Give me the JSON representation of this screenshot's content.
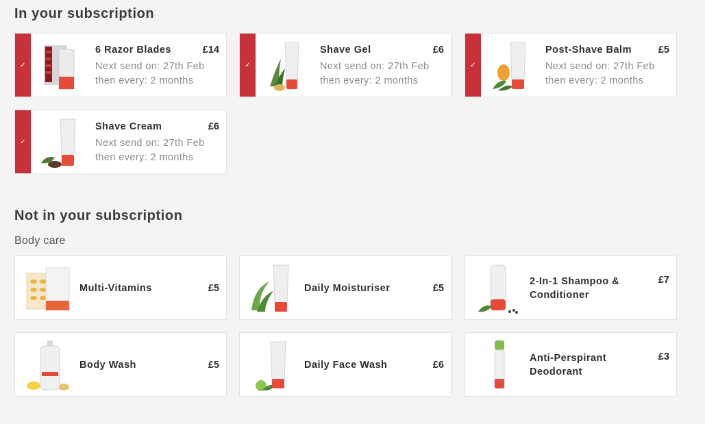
{
  "in_subscription": {
    "title": "In your subscription",
    "items": [
      {
        "name": "6 Razor Blades",
        "price": "£14",
        "next_send": "Next send on: 27th Feb",
        "frequency": "then every: 2 months"
      },
      {
        "name": "Shave Gel",
        "price": "£6",
        "next_send": "Next send on: 27th Feb",
        "frequency": "then every: 2 months"
      },
      {
        "name": "Post-Shave Balm",
        "price": "£5",
        "next_send": "Next send on: 27th Feb",
        "frequency": "then every: 2 months"
      },
      {
        "name": "Shave Cream",
        "price": "£6",
        "next_send": "Next send on: 27th Feb",
        "frequency": "then every: 2 months"
      }
    ]
  },
  "not_in_subscription": {
    "title": "Not in your subscription",
    "category": "Body care",
    "items": [
      {
        "name": "Multi-Vitamins",
        "price": "£5"
      },
      {
        "name": "Daily Moisturiser",
        "price": "£5"
      },
      {
        "name": "2-In-1 Shampoo & Conditioner",
        "price": "£7"
      },
      {
        "name": "Body Wash",
        "price": "£5"
      },
      {
        "name": "Daily Face Wash",
        "price": "£6"
      },
      {
        "name": "Anti-Perspirant Deodorant",
        "price": "£3"
      }
    ]
  },
  "colors": {
    "accent": "#c8303a",
    "background": "#f4f4f4"
  }
}
